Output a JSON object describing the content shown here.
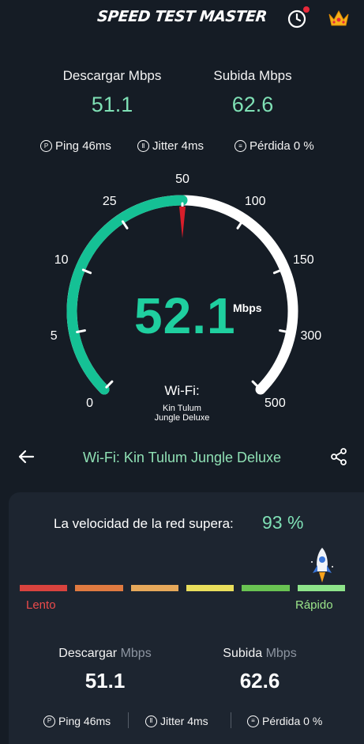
{
  "header": {
    "title": "SPEED TEST MASTER"
  },
  "top_stats": {
    "download_label": "Descargar Mbps",
    "download_value": "51.1",
    "upload_label": "Subida Mbps",
    "upload_value": "62.6",
    "ping": "Ping 46ms",
    "jitter": "Jitter 4ms",
    "loss": "Pérdida 0 %"
  },
  "gauge": {
    "ticks": [
      "0",
      "5",
      "10",
      "25",
      "50",
      "100",
      "150",
      "300",
      "500"
    ],
    "speed": "52.1",
    "unit": "Mbps",
    "connection_label": "Wi-Fi:",
    "network_line1": "Kin Tulum",
    "network_line2": "Jungle Deluxe",
    "progress_fraction": 0.5,
    "colors": {
      "filled": "#15c195",
      "empty": "#ffffff",
      "needle": "#d81e2a"
    }
  },
  "nav": {
    "network_title": "Wi-Fi: Kin Tulum Jungle Deluxe"
  },
  "result": {
    "exceeds_label": "La velocidad de la red supera:",
    "exceeds_value": "93 %",
    "scale": [
      "#d9433e",
      "#e07a40",
      "#e6a85a",
      "#e9de5c",
      "#69c352",
      "#8ee48a"
    ],
    "slow_label": "Lento",
    "fast_label": "Rápido"
  },
  "summary": {
    "download_label": "Descargar",
    "download_unit": "Mbps",
    "download_value": "51.1",
    "upload_label": "Subida",
    "upload_unit": "Mbps",
    "upload_value": "62.6",
    "ping": "Ping 46ms",
    "jitter": "Jitter 4ms",
    "loss": "Pérdida 0 %"
  }
}
